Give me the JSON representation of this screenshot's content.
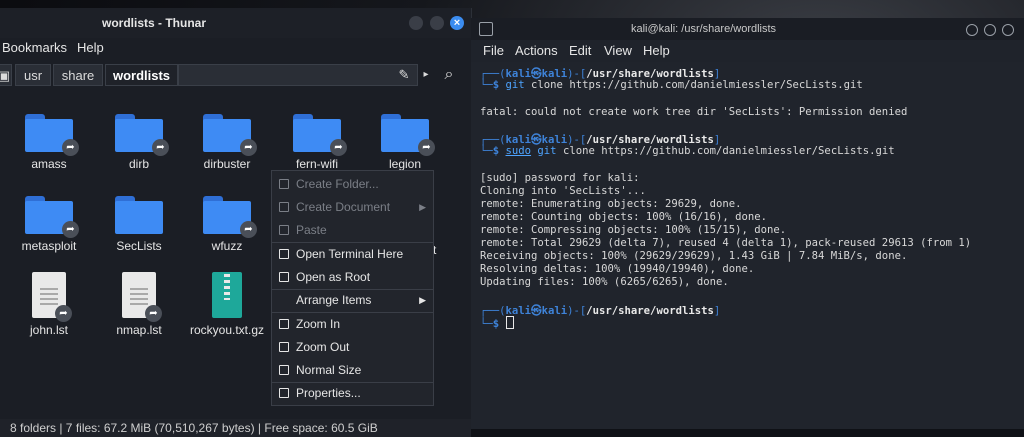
{
  "thunar": {
    "title": "wordlists - Thunar",
    "menu": [
      "Bookmarks",
      "Help"
    ],
    "path": [
      "usr",
      "share",
      "wordlists"
    ],
    "items": [
      {
        "name": "amass",
        "kind": "folder",
        "link": true
      },
      {
        "name": "dirb",
        "kind": "folder",
        "link": true
      },
      {
        "name": "dirbuster",
        "kind": "folder",
        "link": true
      },
      {
        "name": "fern-wifi",
        "kind": "folder",
        "link": true
      },
      {
        "name": "legion",
        "kind": "folder",
        "link": true
      },
      {
        "name": "metasploit",
        "kind": "folder",
        "link": true
      },
      {
        "name": "SecLists",
        "kind": "folder",
        "link": false
      },
      {
        "name": "wfuzz",
        "kind": "folder",
        "link": true
      },
      {
        "name": "john.lst",
        "kind": "doc",
        "link": true
      },
      {
        "name": "nmap.lst",
        "kind": "doc",
        "link": true
      },
      {
        "name": "rockyou.txt.gz",
        "kind": "zip",
        "link": false
      }
    ],
    "partial_label": "t",
    "status": "8 folders  |  7 files: 67.2 MiB (70,510,267 bytes)  |  Free space: 60.5 GiB"
  },
  "context_menu": [
    {
      "label": "Create Folder...",
      "enabled": false,
      "submenu": false
    },
    {
      "label": "Create Document",
      "enabled": false,
      "submenu": true
    },
    {
      "label": "Paste",
      "enabled": false,
      "submenu": false
    },
    {
      "label": "Open Terminal Here",
      "enabled": true,
      "submenu": false
    },
    {
      "label": "Open as Root",
      "enabled": true,
      "submenu": false
    },
    {
      "label": "Arrange Items",
      "enabled": true,
      "submenu": true
    },
    {
      "label": "Zoom In",
      "enabled": true,
      "submenu": false
    },
    {
      "label": "Zoom Out",
      "enabled": true,
      "submenu": false
    },
    {
      "label": "Normal Size",
      "enabled": true,
      "submenu": false
    },
    {
      "label": "Properties...",
      "enabled": true,
      "submenu": false
    }
  ],
  "terminal": {
    "title": "kali@kali: /usr/share/wordlists",
    "menu": [
      "File",
      "Actions",
      "Edit",
      "View",
      "Help"
    ],
    "prompt": {
      "user": "kali",
      "at": "㉿",
      "host": "kali",
      "cwd": "/usr/share/wordlists"
    },
    "cmd1": "git clone https://github.com/danielmiessler/SecLists.git",
    "cmd1_head": "git",
    "cmd1_rest": " clone https://github.com/danielmiessler/SecLists.git",
    "err1": "fatal: could not create work tree dir 'SecLists': Permission denied",
    "cmd2_head": "sudo",
    "cmd2_mid": " git",
    "cmd2_rest": " clone https://github.com/danielmiessler/SecLists.git",
    "output": [
      "[sudo] password for kali:",
      "Cloning into 'SecLists'...",
      "remote: Enumerating objects: 29629, done.",
      "remote: Counting objects: 100% (16/16), done.",
      "remote: Compressing objects: 100% (15/15), done.",
      "remote: Total 29629 (delta 7), reused 4 (delta 1), pack-reused 29613 (from 1)",
      "Receiving objects: 100% (29629/29629), 1.43 GiB | 7.84 MiB/s, done.",
      "Resolving deltas: 100% (19940/19940), done.",
      "Updating files: 100% (6265/6265), done."
    ]
  },
  "colors": {
    "accent": "#3e8bf4",
    "prompt_blue": "#3e83d9",
    "command_blue": "#4ea4ff"
  }
}
